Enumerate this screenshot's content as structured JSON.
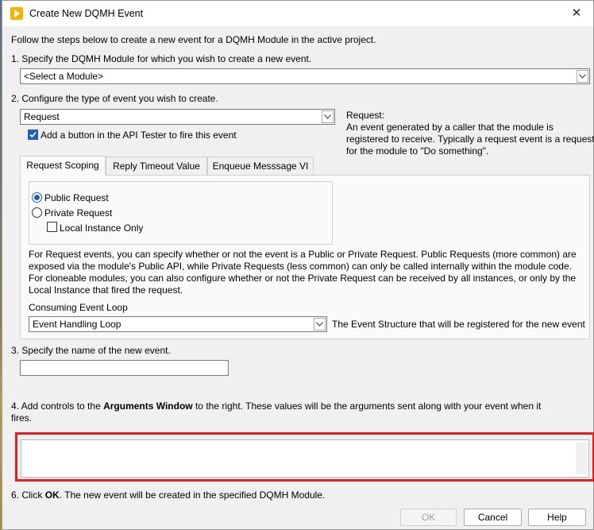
{
  "window": {
    "title": "Create New DQMH Event",
    "close_glyph": "✕"
  },
  "intro": "Follow the steps below to create a new event for a DQMH Module in the active project.",
  "step1": {
    "label": "1. Specify the DQMH Module for which you wish to create a new event.",
    "module_select": "<Select a Module>"
  },
  "step2": {
    "label": "2. Configure the type of event you wish to create.",
    "event_type": "Request",
    "api_tester_checkbox": {
      "label": "Add a button in the API Tester to fire this event",
      "checked": true
    },
    "description_title": "Request:",
    "description_lines": [
      "An event generated by a caller that the module is",
      "registered to receive. Typically a request event is a request",
      "for the module to \"Do something\"."
    ],
    "tabs": [
      "Request Scoping",
      "Reply Timeout Value",
      "Enqueue Messsage VI"
    ],
    "active_tab": "Request Scoping",
    "scope": {
      "public": "Public Request",
      "private": "Private Request",
      "local_only": "Local Instance Only",
      "selected": "public",
      "local_only_checked": false
    },
    "scope_help_lines": [
      "For Request events, you can specify whether or not the event is a Public or Private Request. Public Requests (more common) are",
      "exposed via the module's Public API, while Private Requests (less common) can only be called internally within the module code.",
      "For cloneable modules, you can also configure whether or not the Private Request can be received by all instances, or only by the",
      "Local Instance that fired the request."
    ],
    "consuming_loop_label": "Consuming Event Loop",
    "consuming_loop_value": "Event Handling Loop",
    "consuming_loop_note": "The Event Structure that will be registered for the new event"
  },
  "step3": {
    "label": "3. Specify the name of the new event.",
    "name_value": ""
  },
  "step4": {
    "prefix": "4. Add controls to the ",
    "bold": "Arguments Window",
    "suffix_line1": " to the right. These values will be the arguments sent along with your event when it",
    "line2": "fires."
  },
  "step6": {
    "prefix": "6. Click ",
    "bold": "OK",
    "suffix": ". The new event will be created in the specified DQMH Module."
  },
  "buttons": {
    "ok": "OK",
    "cancel": "Cancel",
    "help": "Help"
  },
  "colors": {
    "highlight_border": "#e02020",
    "checkbox_accent": "#1f5fb8",
    "app_icon": "#f4b400"
  }
}
